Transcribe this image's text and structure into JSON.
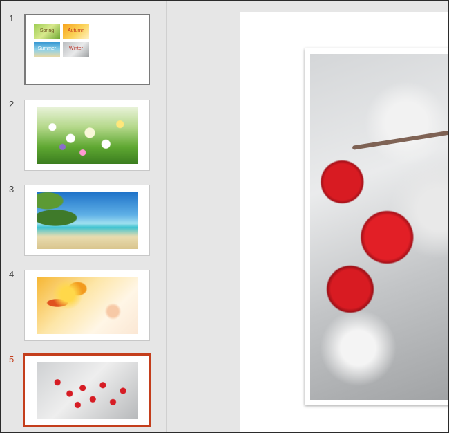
{
  "thumbnails": [
    {
      "number": "1",
      "tiles": [
        "Spring",
        "Autumn",
        "Summer",
        "Winter"
      ]
    },
    {
      "number": "2",
      "image": "spring-flowers-photo"
    },
    {
      "number": "3",
      "image": "tropical-beach-photo"
    },
    {
      "number": "4",
      "image": "autumn-leaves-photo"
    },
    {
      "number": "5",
      "image": "winter-berries-photo",
      "selected": true
    }
  ],
  "main_slide": {
    "image": "frosted-red-berries-photo"
  },
  "colors": {
    "selection_accent": "#c43e1c",
    "pane_background": "#e6e6e6"
  }
}
